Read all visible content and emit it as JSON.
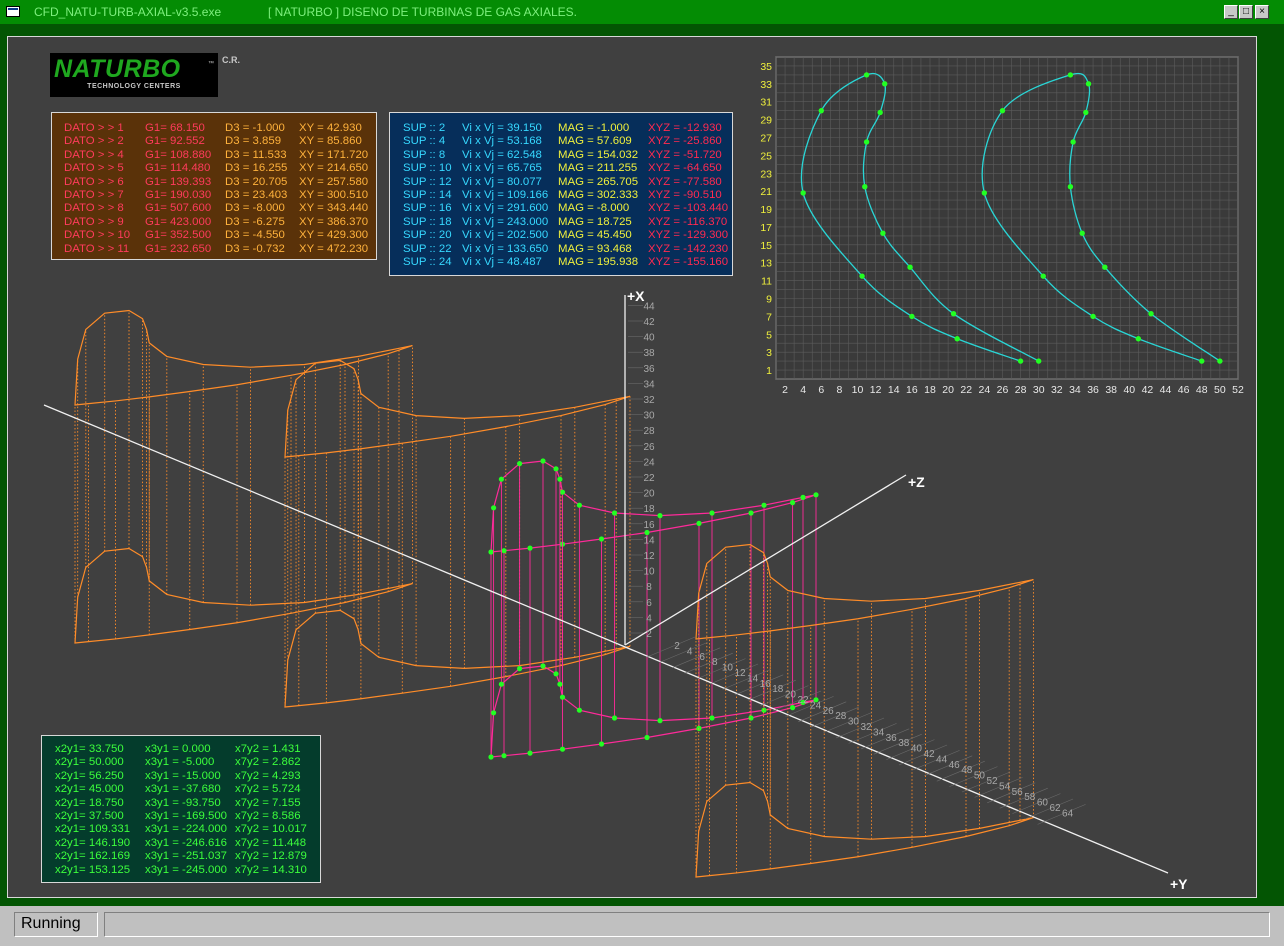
{
  "window": {
    "title_left": "CFD_NATU-TURB-AXIAL-v3.5.exe",
    "title_center": "[ NATURBO ] DISENO DE TURBINAS DE GAS AXIALES.",
    "buttons": {
      "min": "_",
      "max": "□",
      "close": "×"
    }
  },
  "status": {
    "text": "Running"
  },
  "logo": {
    "name": "NATURBO",
    "tm": "™",
    "sub": "TECHNOLOGY CENTERS",
    "cr": "C.R."
  },
  "colors": {
    "dato_text": "#ff3b5c",
    "dato_g1": "#ff3b5c",
    "dato_d3": "#ffb23c",
    "dato_xy": "#ffb23c",
    "sup_text": "#36d8ff",
    "mag": "#f0f03c",
    "xyz": "#ff2a50",
    "xpanel": "#3cff3c",
    "blade": "#ff8c28",
    "blade_magenta": "#ff2a9a",
    "profile": "#29d6d6",
    "points": "#22ff22"
  },
  "dato_table": [
    {
      "dato": "DATO > > 1",
      "g1": "G1= 68.150",
      "d3": "D3 = -1.000",
      "xy": "XY = 42.930"
    },
    {
      "dato": "DATO > > 2",
      "g1": "G1= 92.552",
      "d3": "D3 = 3.859",
      "xy": "XY = 85.860"
    },
    {
      "dato": "DATO > > 4",
      "g1": "G1= 108.880",
      "d3": "D3 = 11.533",
      "xy": "XY = 171.720"
    },
    {
      "dato": "DATO > > 5",
      "g1": "G1= 114.480",
      "d3": "D3 = 16.255",
      "xy": "XY = 214.650"
    },
    {
      "dato": "DATO > > 6",
      "g1": "G1= 139.393",
      "d3": "D3 = 20.705",
      "xy": "XY = 257.580"
    },
    {
      "dato": "DATO > > 7",
      "g1": "G1= 190.030",
      "d3": "D3 = 23.403",
      "xy": "XY = 300.510"
    },
    {
      "dato": "DATO > > 8",
      "g1": "G1= 507.600",
      "d3": "D3 = -8.000",
      "xy": "XY = 343.440"
    },
    {
      "dato": "DATO > > 9",
      "g1": "G1= 423.000",
      "d3": "D3 = -6.275",
      "xy": "XY = 386.370"
    },
    {
      "dato": "DATO > > 10",
      "g1": "G1= 352.500",
      "d3": "D3 = -4.550",
      "xy": "XY = 429.300"
    },
    {
      "dato": "DATO > > 11",
      "g1": "G1= 232.650",
      "d3": "D3 = -0.732",
      "xy": "XY = 472.230"
    }
  ],
  "sup_table": [
    {
      "sup": "SUP :: 2",
      "vi": "Vi x Vj = 39.150",
      "mag": "MAG = -1.000",
      "xyz": "XYZ = -12.930"
    },
    {
      "sup": "SUP :: 4",
      "vi": "Vi x Vj = 53.168",
      "mag": "MAG = 57.609",
      "xyz": "XYZ = -25.860"
    },
    {
      "sup": "SUP :: 8",
      "vi": "Vi x Vj = 62.548",
      "mag": "MAG = 154.032",
      "xyz": "XYZ = -51.720"
    },
    {
      "sup": "SUP :: 10",
      "vi": "Vi x Vj = 65.765",
      "mag": "MAG = 211.255",
      "xyz": "XYZ = -64.650"
    },
    {
      "sup": "SUP :: 12",
      "vi": "Vi x Vj = 80.077",
      "mag": "MAG = 265.705",
      "xyz": "XYZ = -77.580"
    },
    {
      "sup": "SUP :: 14",
      "vi": "Vi x Vj = 109.166",
      "mag": "MAG = 302.333",
      "xyz": "XYZ = -90.510"
    },
    {
      "sup": "SUP :: 16",
      "vi": "Vi x Vj = 291.600",
      "mag": "MAG = -8.000",
      "xyz": "XYZ = -103.440"
    },
    {
      "sup": "SUP :: 18",
      "vi": "Vi x Vj = 243.000",
      "mag": "MAG = 18.725",
      "xyz": "XYZ = -116.370"
    },
    {
      "sup": "SUP :: 20",
      "vi": "Vi x Vj = 202.500",
      "mag": "MAG = 45.450",
      "xyz": "XYZ = -129.300"
    },
    {
      "sup": "SUP :: 22",
      "vi": "Vi x Vj = 133.650",
      "mag": "MAG = 93.468",
      "xyz": "XYZ = -142.230"
    },
    {
      "sup": "SUP :: 24",
      "vi": "Vi x Vj = 48.487",
      "mag": "MAG = 195.938",
      "xyz": "XYZ = -155.160"
    }
  ],
  "x_table": [
    {
      "a": "x2y1= 33.750",
      "b": "x3y1 = 0.000",
      "c": "x7y2 = 1.431"
    },
    {
      "a": "x2y1= 50.000",
      "b": "x3y1 = -5.000",
      "c": "x7y2 = 2.862"
    },
    {
      "a": "x2y1= 56.250",
      "b": "x3y1 = -15.000",
      "c": "x7y2 = 4.293"
    },
    {
      "a": "x2y1= 45.000",
      "b": "x3y1 = -37.680",
      "c": "x7y2 = 5.724"
    },
    {
      "a": "x2y1= 18.750",
      "b": "x3y1 = -93.750",
      "c": "x7y2 = 7.155"
    },
    {
      "a": "x2y1= 37.500",
      "b": "x3y1 = -169.500",
      "c": "x7y2 = 8.586"
    },
    {
      "a": "x2y1= 109.331",
      "b": "x3y1 = -224.000",
      "c": "x7y2 = 10.017"
    },
    {
      "a": "x2y1= 146.190",
      "b": "x3y1 = -246.616",
      "c": "x7y2 = 11.448"
    },
    {
      "a": "x2y1= 162.169",
      "b": "x3y1 = -251.037",
      "c": "x7y2 = 12.879"
    },
    {
      "a": "x2y1= 153.125",
      "b": "x3y1 = -245.000",
      "c": "x7y2 = 14.310"
    }
  ],
  "chart_data": {
    "type": "line",
    "title": "",
    "xlabel": "",
    "ylabel": "",
    "xlim": [
      1,
      52
    ],
    "ylim": [
      0,
      36
    ],
    "grid": true,
    "xticks": [
      2,
      4,
      6,
      8,
      10,
      12,
      14,
      16,
      18,
      20,
      22,
      24,
      26,
      28,
      30,
      32,
      34,
      36,
      38,
      40,
      42,
      44,
      46,
      48,
      50,
      52
    ],
    "yticks": [
      1,
      3,
      5,
      7,
      9,
      11,
      13,
      15,
      17,
      19,
      21,
      23,
      25,
      27,
      29,
      31,
      33,
      35
    ],
    "series": [
      {
        "name": "",
        "points": [
          [
            28,
            2
          ],
          [
            21,
            4.5
          ],
          [
            16,
            7
          ],
          [
            10.5,
            11.5
          ],
          [
            4,
            20.8
          ],
          [
            6,
            30
          ],
          [
            11,
            34
          ],
          [
            13,
            33
          ],
          [
            12.5,
            29.8
          ],
          [
            11,
            26.5
          ],
          [
            10.8,
            21.5
          ],
          [
            12.8,
            16.3
          ],
          [
            15.8,
            12.5
          ],
          [
            20.6,
            7.3
          ],
          [
            30,
            2
          ]
        ]
      },
      {
        "name": "",
        "points": [
          [
            48,
            2
          ],
          [
            41,
            4.5
          ],
          [
            36,
            7
          ],
          [
            30.5,
            11.5
          ],
          [
            24,
            20.8
          ],
          [
            26,
            30
          ],
          [
            33.5,
            34
          ],
          [
            35.5,
            33
          ],
          [
            35.2,
            29.8
          ],
          [
            33.8,
            26.5
          ],
          [
            33.5,
            21.5
          ],
          [
            34.8,
            16.3
          ],
          [
            37.3,
            12.5
          ],
          [
            42.4,
            7.3
          ],
          [
            50,
            2
          ]
        ]
      }
    ]
  },
  "axes3d": {
    "x_label": "+X",
    "y_label": "+Y",
    "z_label": "+Z",
    "x_ticks": [
      "2",
      "4",
      "6",
      "8",
      "10",
      "12",
      "14",
      "16",
      "18",
      "20",
      "22",
      "24",
      "26",
      "28",
      "30",
      "32",
      "34",
      "36",
      "38",
      "40",
      "42",
      "44"
    ],
    "y_ticks": [
      "2",
      "4",
      "6",
      "8",
      "10",
      "12",
      "14",
      "16",
      "18",
      "20",
      "22",
      "24",
      "26",
      "28",
      "30",
      "32",
      "34",
      "36",
      "38",
      "40",
      "42",
      "44",
      "46",
      "48",
      "50",
      "52",
      "54",
      "56",
      "58",
      "60",
      "62",
      "64"
    ]
  }
}
